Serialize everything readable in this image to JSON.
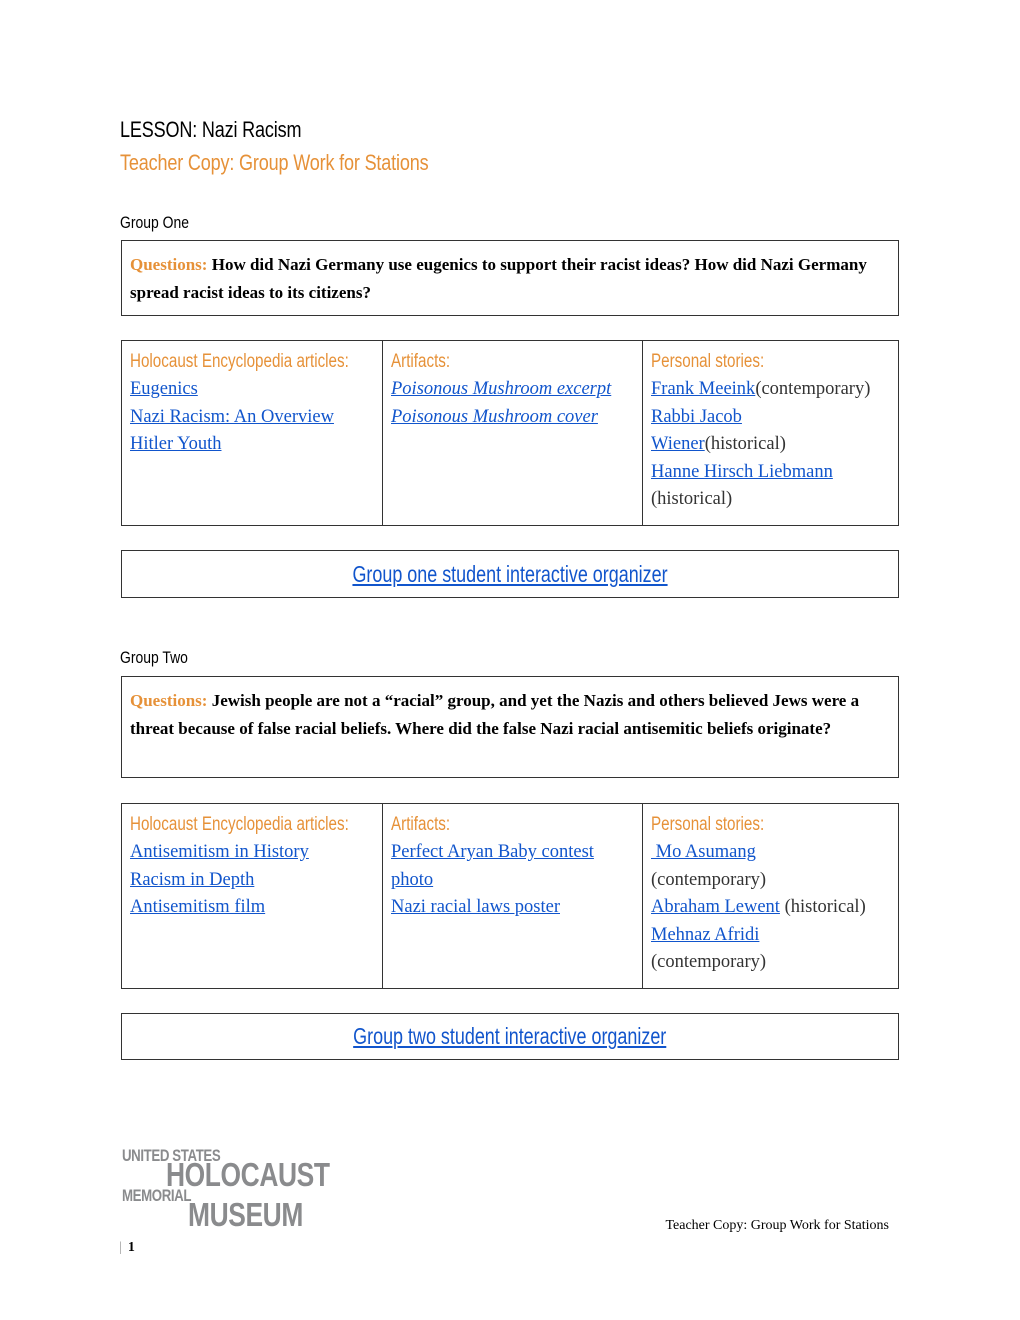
{
  "header": {
    "lesson_title": "LESSON: Nazi Racism",
    "subtitle": "Teacher Copy: Group Work for Stations"
  },
  "colors": {
    "accent_orange": "#e69138",
    "link_blue": "#1155cc",
    "logo_gray": "#8a8b8d"
  },
  "groups": [
    {
      "heading": "Group One",
      "questions_label": "Questions:",
      "questions_text": "How did Nazi Germany use eugenics to support their racist ideas? How did Nazi Germany spread racist ideas to its citizens?",
      "columns": {
        "articles_header": "Holocaust Encyclopedia articles:",
        "artifacts_header": "Artifacts:",
        "stories_header": "Personal stories:"
      },
      "articles": [
        "Eugenics",
        "Nazi Racism: An Overview",
        "Hitler Youth"
      ],
      "artifacts": [
        "Poisonous Mushroom excerpt",
        "Poisonous Mushroom cover"
      ],
      "stories": [
        {
          "lines": [
            {
              "link": "Frank Meeink",
              "note": "(contemporary)"
            }
          ]
        },
        {
          "lines": [
            {
              "link": "Rabbi Jacob",
              "note": ""
            },
            {
              "link": "Wiener",
              "note": "(historical)"
            }
          ]
        },
        {
          "lines": [
            {
              "link": "Hanne Hirsch Liebmann",
              "note": ""
            },
            {
              "link": "",
              "note": "(historical)"
            }
          ]
        }
      ],
      "organizer_link": "Group one student interactive organizer"
    },
    {
      "heading": "Group Two",
      "questions_label": "Questions:",
      "questions_text": "Jewish people are not a “racial” group, and yet the Nazis and others believed Jews were a threat because of false racial beliefs. Where did the false Nazi racial antisemitic beliefs originate?",
      "columns": {
        "articles_header": "Holocaust Encyclopedia articles:",
        "artifacts_header": "Artifacts:",
        "stories_header": "Personal stories:"
      },
      "articles": [
        "Antisemitism in History",
        "Racism in Depth",
        "Antisemitism film"
      ],
      "artifacts_lines": [
        "Perfect Aryan Baby contest",
        "photo",
        "Nazi racial laws poster"
      ],
      "stories": [
        {
          "lines": [
            {
              "link": " Mo Asumang",
              "note": ""
            },
            {
              "link": "",
              "note": "(contemporary)"
            }
          ]
        },
        {
          "lines": [
            {
              "link": "Abraham Lewent",
              "note": " (historical)"
            }
          ]
        },
        {
          "lines": [
            {
              "link": "Mehnaz Afridi",
              "note": ""
            },
            {
              "link": "",
              "note": "(contemporary)"
            }
          ]
        }
      ],
      "organizer_link": "Group two student interactive organizer"
    }
  ],
  "footer": {
    "logo": {
      "line1": "UNITED STATES",
      "line2": "HOLOCAUST",
      "line3": "MEMORIAL",
      "line4": "MUSEUM"
    },
    "doc_label": "Teacher Copy: Group Work for Stations",
    "page_number": "1"
  }
}
